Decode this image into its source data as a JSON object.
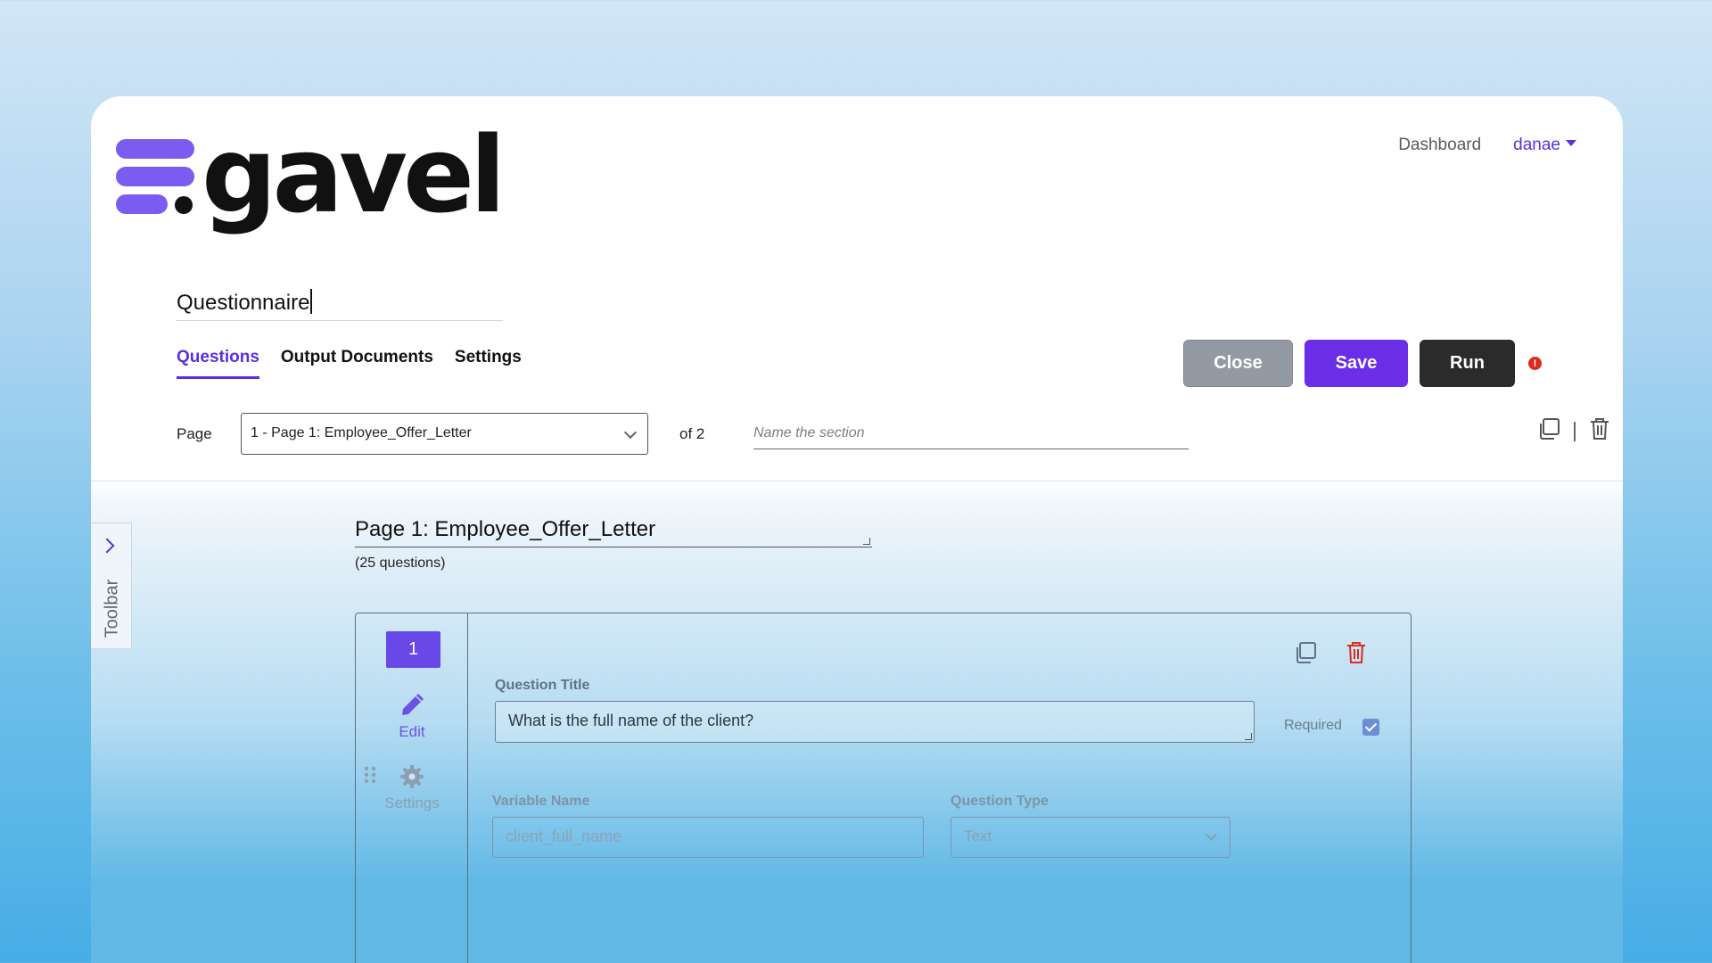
{
  "brand": {
    "name": "gavel"
  },
  "nav": {
    "dashboard": "Dashboard",
    "user": "danae"
  },
  "questionnaire": {
    "title": "Questionnaire"
  },
  "tabs": [
    {
      "label": "Questions",
      "active": true
    },
    {
      "label": "Output Documents",
      "active": false
    },
    {
      "label": "Settings",
      "active": false
    }
  ],
  "actions": {
    "close": "Close",
    "save": "Save",
    "run": "Run",
    "alert": "!"
  },
  "page_selector": {
    "label": "Page",
    "selected": "1 - Page 1: Employee_Offer_Letter",
    "of_total": "of 2",
    "section_placeholder": "Name the section"
  },
  "toolbar": {
    "label": "Toolbar"
  },
  "page": {
    "heading": "Page 1: Employee_Offer_Letter",
    "question_count": "(25 questions)"
  },
  "question": {
    "number": "1",
    "edit_label": "Edit",
    "settings_label": "Settings",
    "title_label": "Question Title",
    "title_value": "What is the full name of the client?",
    "required_label": "Required",
    "required_checked": true,
    "variable_label": "Variable Name",
    "variable_value": "client_full_name",
    "type_label": "Question Type",
    "type_value": "Text"
  },
  "colors": {
    "accent": "#5b2fe0",
    "save": "#6a2ee8",
    "run": "#2b2b2b",
    "close": "#939aa3",
    "danger": "#d92d20"
  }
}
